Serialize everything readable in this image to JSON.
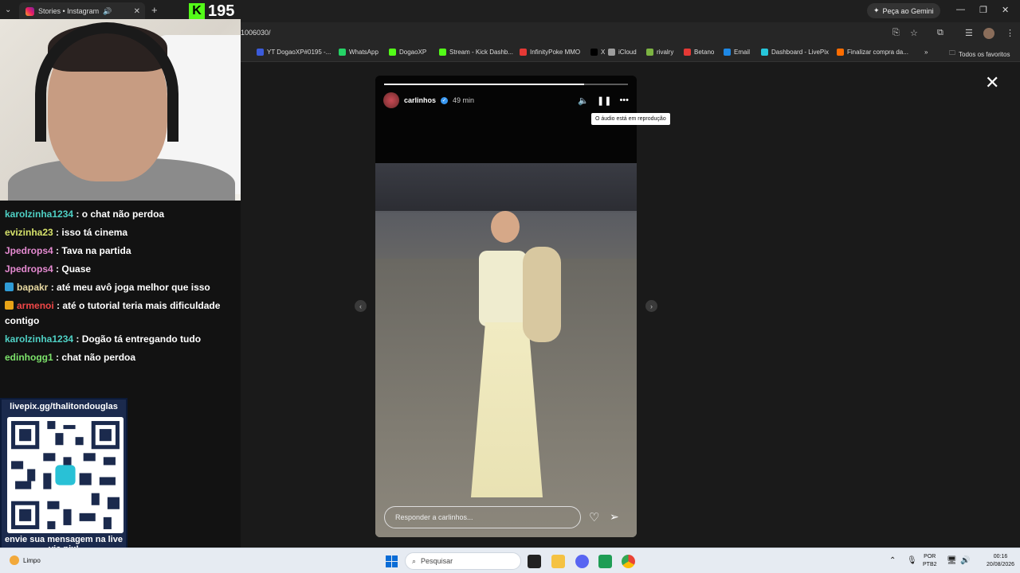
{
  "browser": {
    "tab_title": "Stories • Instagram",
    "gemini_label": "Peça ao Gemini",
    "url_fragment": "1006030/",
    "bookmarks": [
      {
        "label": "YT DogaoXP#0195 -...",
        "color": "#3b5bdb"
      },
      {
        "label": "WhatsApp",
        "color": "#25d366"
      },
      {
        "label": "DogaoXP",
        "color": "#53fc18"
      },
      {
        "label": "Stream - Kick Dashb...",
        "color": "#53fc18"
      },
      {
        "label": "InfinityPoke MMO",
        "color": "#e53935"
      },
      {
        "label": "X",
        "color": "#000000"
      },
      {
        "label": "iCloud",
        "color": "#9e9e9e"
      },
      {
        "label": "rivalry",
        "color": "#7cb342"
      },
      {
        "label": "Betano",
        "color": "#e53935"
      },
      {
        "label": "Email",
        "color": "#1e88e5"
      },
      {
        "label": "Dashboard - LivePix",
        "color": "#26c6da"
      },
      {
        "label": "Finalizar compra da...",
        "color": "#ff6d00"
      }
    ],
    "all_bookmarks_label": "Todos os favoritos"
  },
  "stream": {
    "viewer_count": "195"
  },
  "chat": {
    "messages": [
      {
        "user": "karolzinha1234",
        "text": ": o chat não perdoa",
        "user_color": "#4fd1c5",
        "badge": null
      },
      {
        "user": "evizinha23",
        "text": ": isso tá cinema",
        "user_color": "#d7e36b",
        "badge": null
      },
      {
        "user": "Jpedrops4",
        "text": ": Tava na partida",
        "user_color": "#e58ad1",
        "badge": null
      },
      {
        "user": "Jpedrops4",
        "text": ": Quase",
        "user_color": "#e58ad1",
        "badge": null
      },
      {
        "user": "bapakr",
        "text": ": até meu avô joga melhor que isso",
        "user_color": "#e8d9a1",
        "badge": "#2f9cd6"
      },
      {
        "user": "armenoi",
        "text": ": até o tutorial teria mais dificuldade contigo",
        "user_color": "#f04747",
        "badge": "#e8a317"
      },
      {
        "user": "karolzinha1234",
        "text": ": Dogão tá entregando tudo",
        "user_color": "#4fd1c5",
        "badge": null
      },
      {
        "user": "edinhogg1",
        "text": ": chat não perdoa",
        "user_color": "#7de36b",
        "badge": null
      }
    ]
  },
  "livepix": {
    "url": "livepix.gg/thalitondouglas",
    "cta": "envie sua mensagem na live via pix!"
  },
  "story": {
    "username": "carlinhos",
    "time_ago": "49 min",
    "tooltip": "O áudio está em reprodução",
    "reply_placeholder": "Responder a carlinhos...",
    "progress": 0.82
  },
  "taskbar": {
    "weather": "Limpo",
    "search_placeholder": "Pesquisar",
    "lang_line1": "POR",
    "lang_line2": "PTB2",
    "time": "00:16",
    "date": "20/08/2026"
  }
}
